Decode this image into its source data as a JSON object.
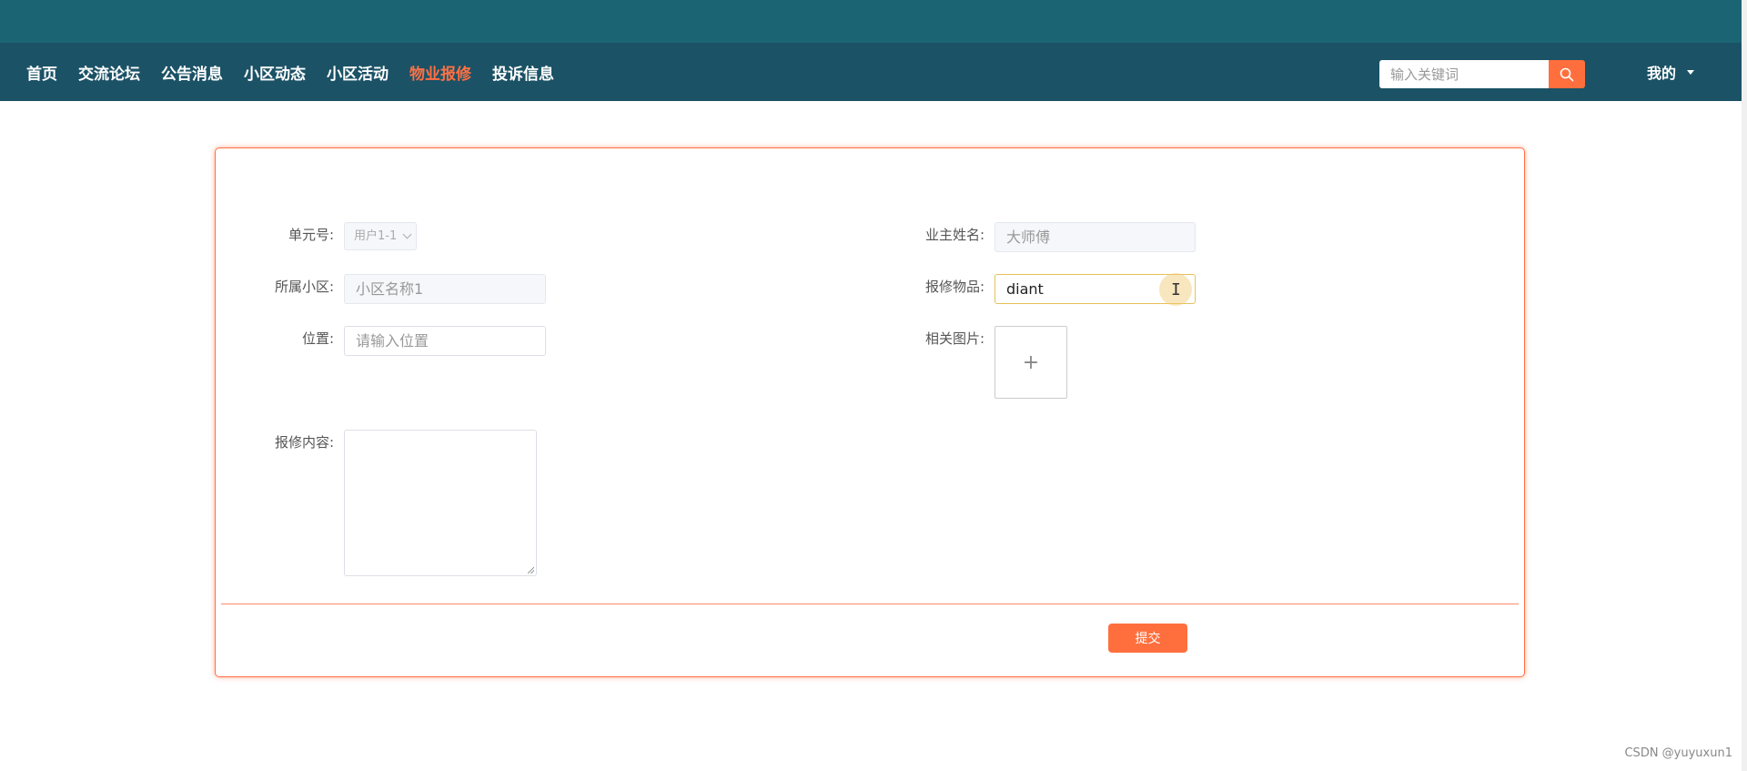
{
  "nav": {
    "items": [
      "首页",
      "交流论坛",
      "公告消息",
      "小区动态",
      "小区活动",
      "物业报修",
      "投诉信息"
    ],
    "active": "物业报修",
    "search_placeholder": "输入关键词",
    "user_label": "我的"
  },
  "form": {
    "unit_label": "单元号:",
    "unit_value": "用户1-1",
    "owner_label": "业主姓名:",
    "owner_value": "大师傅",
    "community_label": "所属小区:",
    "community_value": "小区名称1",
    "item_label": "报修物品:",
    "item_value": "diant",
    "location_label": "位置:",
    "location_placeholder": "请输入位置",
    "image_label": "相关图片:",
    "upload_symbol": "+",
    "content_label": "报修内容:",
    "submit_label": "提交"
  },
  "watermark": "CSDN @yuyuxun1",
  "colors": {
    "topbar": "#1b6474",
    "navbar": "#1b5266",
    "accent": "#ff6f3d",
    "active_nav": "#ff7043"
  }
}
